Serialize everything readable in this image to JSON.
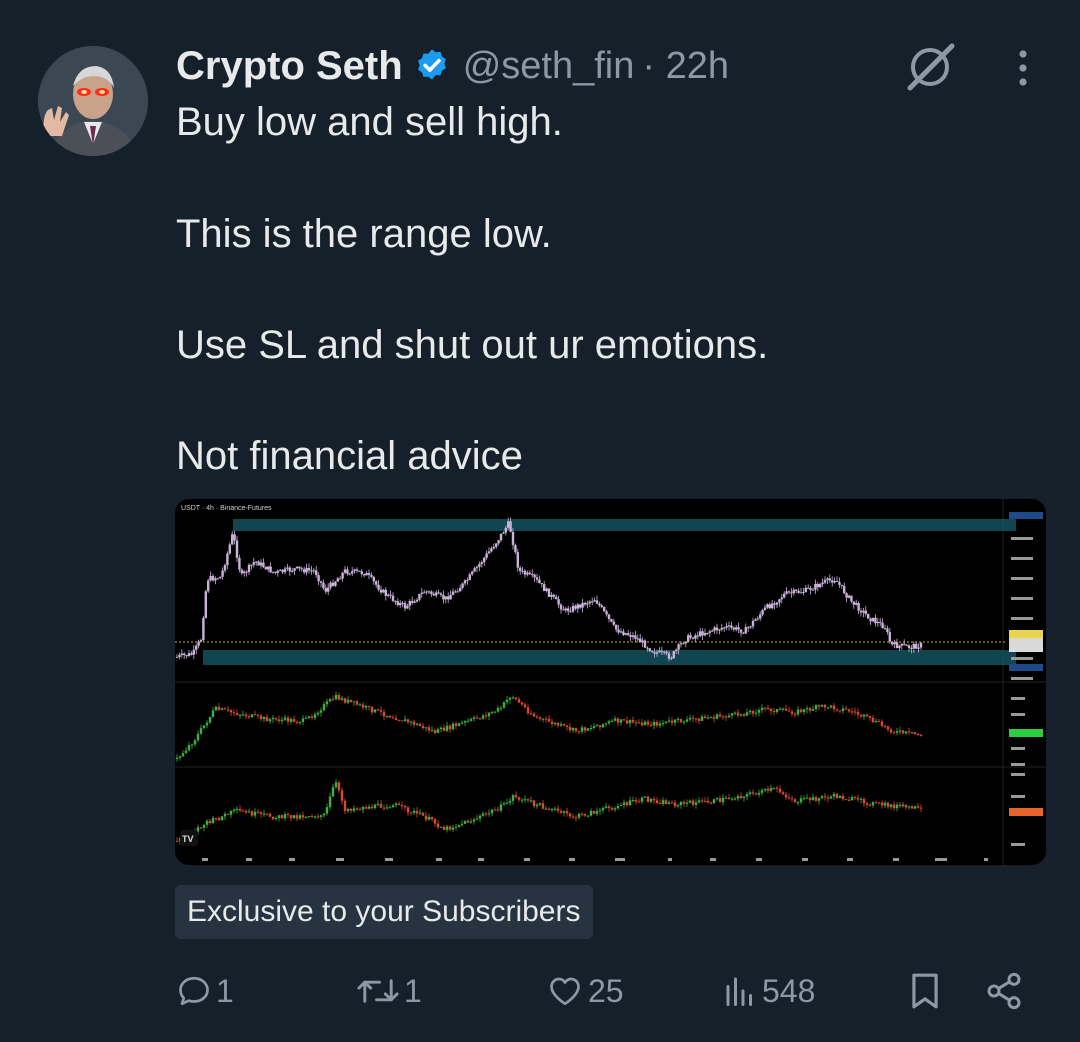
{
  "author": {
    "display_name": "Crypto Seth",
    "handle": "@seth_fin",
    "time": "· 22h",
    "verified": true
  },
  "post": {
    "lines": [
      "Buy low and sell high.",
      "This is the range low.",
      "Use SL and shut out ur emotions.",
      "Not financial advice"
    ]
  },
  "media": {
    "chart_header": "USDT · 4h · Binance-Futures"
  },
  "subscription_label": "Exclusive to your Subscribers",
  "actions": {
    "replies": "1",
    "reposts": "1",
    "likes": "25",
    "views": "548"
  },
  "icons": [
    "verified-badge-icon",
    "grok-icon",
    "more-icon",
    "reply-icon",
    "repost-icon",
    "like-icon",
    "views-icon",
    "bookmark-icon",
    "share-icon"
  ],
  "colors": {
    "background": "#15202b",
    "text": "#e7e9ea",
    "muted": "#8b98a5",
    "verified": "#1d9bf0",
    "chart_background": "#000000",
    "range_zone": "#14525e",
    "candle_up": "#3cb043",
    "candle_down": "#d94b2b",
    "price_line": "#c9b3d9",
    "pill_background": "#273340"
  }
}
